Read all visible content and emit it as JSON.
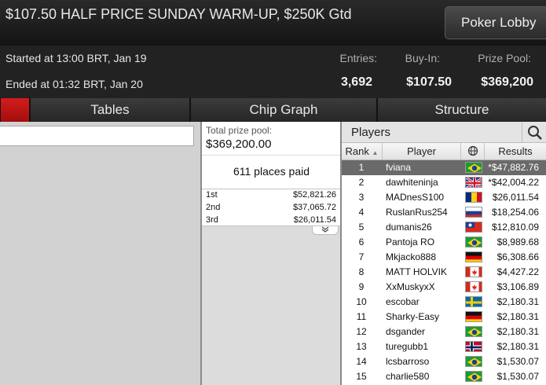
{
  "tournament": {
    "title": "$107.50 HALF PRICE SUNDAY WARM-UP, $250K Gtd",
    "lobby_button": "Poker Lobby",
    "started": "Started at 13:00 BRT, Jan 19",
    "ended": "Ended at 01:32 BRT, Jan 20",
    "entries_label": "Entries:",
    "entries_value": "3,692",
    "buyin_label": "Buy-In:",
    "buyin_value": "$107.50",
    "prizepool_label": "Prize Pool:",
    "prizepool_value": "$369,200"
  },
  "tabs": [
    {
      "label": "Tables"
    },
    {
      "label": "Chip Graph"
    },
    {
      "label": "Structure"
    }
  ],
  "prize": {
    "total_label": "Total prize pool:",
    "total_value": "$369,200.00",
    "places_paid": "611 places paid",
    "rows": [
      {
        "place": "1st",
        "amount": "$52,821.26"
      },
      {
        "place": "2nd",
        "amount": "$37,065.72"
      },
      {
        "place": "3rd",
        "amount": "$26,011.54"
      }
    ],
    "expand_icon": "chevron-double-down"
  },
  "players": {
    "title": "Players",
    "search_icon": "magnifier",
    "columns": {
      "rank": "Rank",
      "player": "Player",
      "country_icon": "globe",
      "results": "Results"
    },
    "rows": [
      {
        "rank": "1",
        "name": "fviana",
        "country": "br",
        "result": "*$47,882.76"
      },
      {
        "rank": "2",
        "name": "dawhiteninja",
        "country": "gb",
        "result": "*$42,004.22"
      },
      {
        "rank": "3",
        "name": "MADnesS100",
        "country": "ro",
        "result": "$26,011.54"
      },
      {
        "rank": "4",
        "name": "RuslanRus254",
        "country": "ru",
        "result": "$18,254.06"
      },
      {
        "rank": "5",
        "name": "dumanis26",
        "country": "tw",
        "result": "$12,810.09"
      },
      {
        "rank": "6",
        "name": "Pantoja RO",
        "country": "br",
        "result": "$8,989.68"
      },
      {
        "rank": "7",
        "name": "Mkjacko888",
        "country": "de",
        "result": "$6,308.66"
      },
      {
        "rank": "8",
        "name": "MATT HOLVIK",
        "country": "ca",
        "result": "$4,427.22"
      },
      {
        "rank": "9",
        "name": "XxMuskyxX",
        "country": "ca",
        "result": "$3,106.89"
      },
      {
        "rank": "10",
        "name": "escobar",
        "country": "se",
        "result": "$2,180.31"
      },
      {
        "rank": "11",
        "name": "Sharky-Easy",
        "country": "de",
        "result": "$2,180.31"
      },
      {
        "rank": "12",
        "name": "dsgander",
        "country": "br",
        "result": "$2,180.31"
      },
      {
        "rank": "13",
        "name": "turegubb1",
        "country": "no",
        "result": "$2,180.31"
      },
      {
        "rank": "14",
        "name": "lcsbarroso",
        "country": "br",
        "result": "$1,530.07"
      },
      {
        "rank": "15",
        "name": "charlie580",
        "country": "br",
        "result": "$1,530.07"
      }
    ]
  }
}
